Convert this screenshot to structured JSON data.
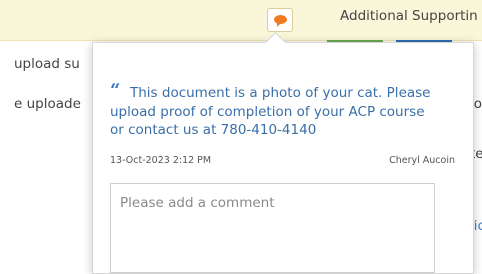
{
  "header": {
    "section_label": "Additional Supportin"
  },
  "background": {
    "row1_text": "upload su",
    "row2_text": "e uploade",
    "right_clip_1": "io",
    "right_clip_2": "te",
    "right_clip_3": "lic"
  },
  "comment_popover": {
    "comment_text": "This document is a photo of your cat. Please upload proof of completion of your ACP course or contact us at 780-410-4140",
    "timestamp": "13-Oct-2023 2:12 PM",
    "author": "Cheryl Aucoin",
    "input_placeholder": "Please add a comment",
    "input_value": ""
  },
  "colors": {
    "accent_orange": "#f07a1f",
    "link_blue": "#3a7bc8",
    "header_bg": "#faf6d9"
  }
}
